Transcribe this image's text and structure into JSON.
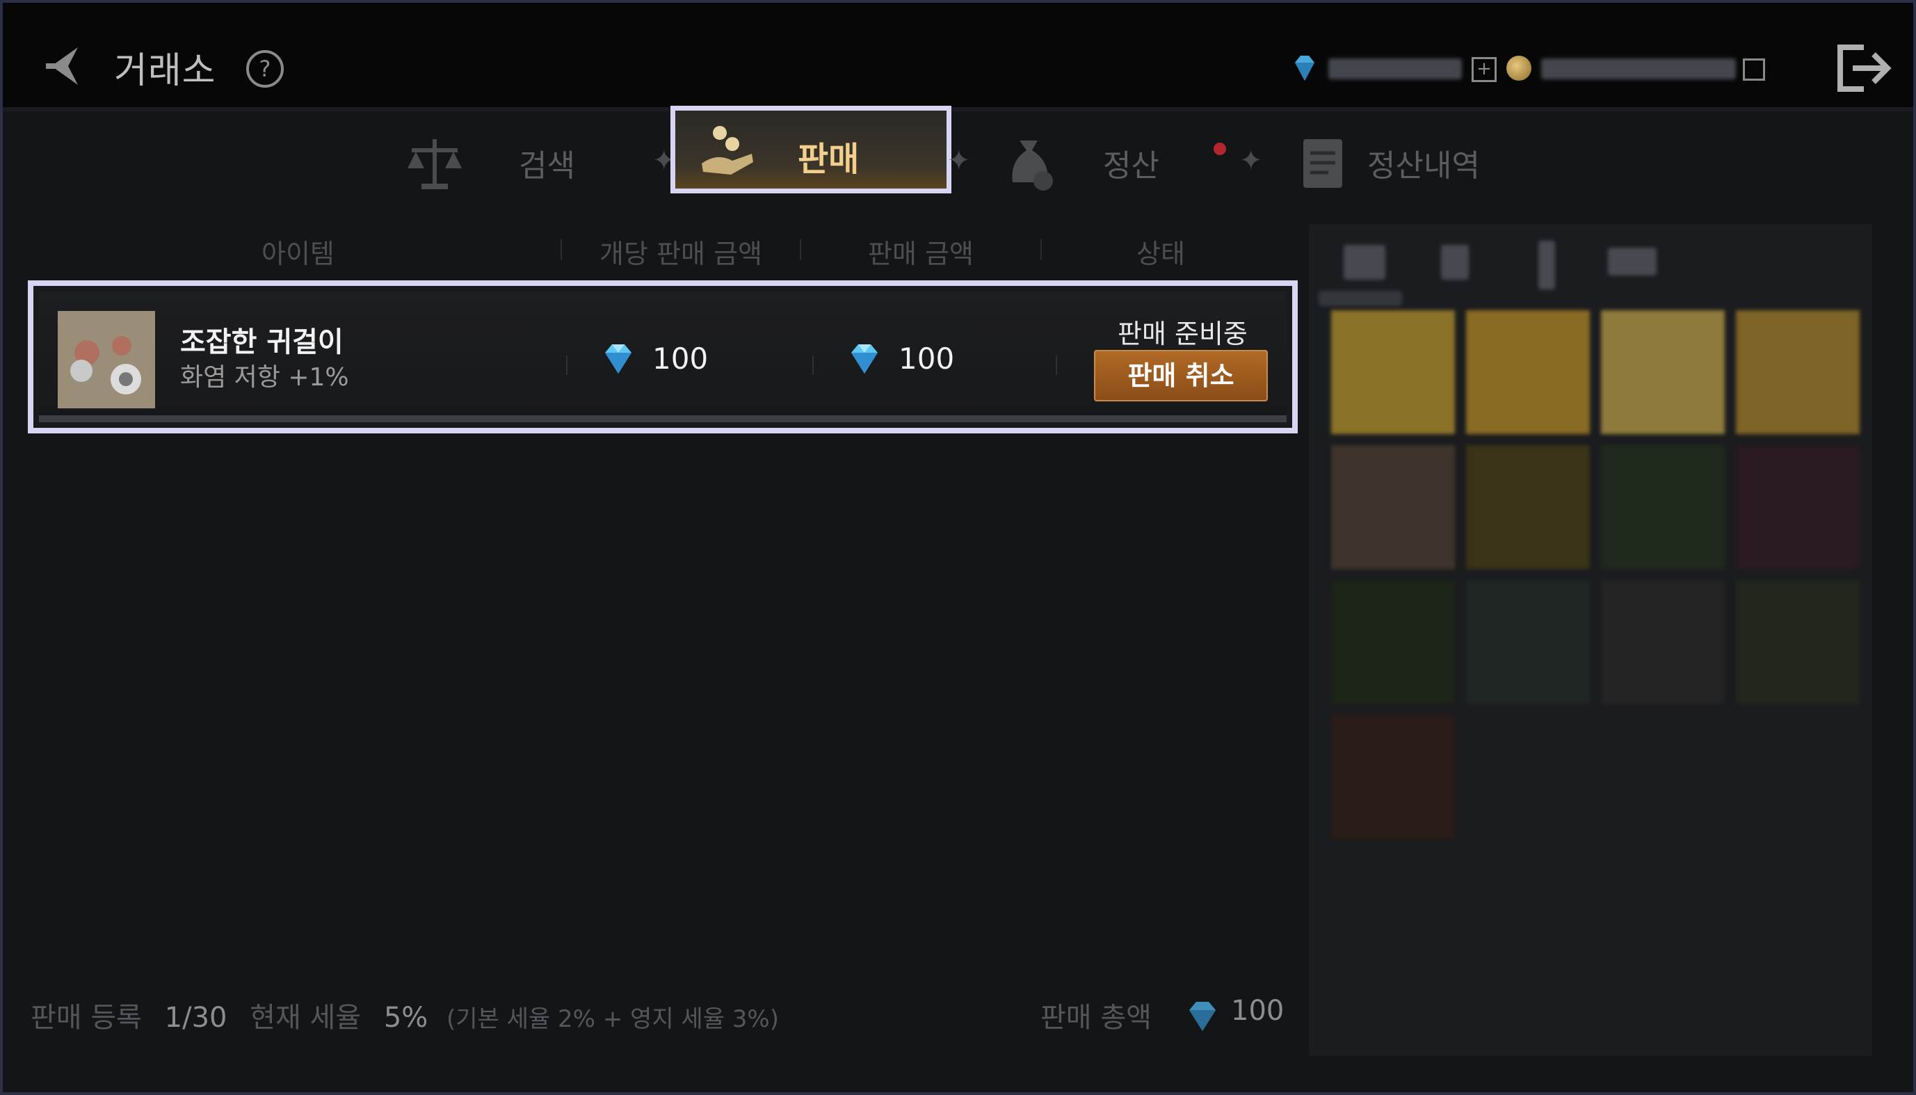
{
  "header": {
    "title": "거래소",
    "help_symbol": "?",
    "diamond_icon": "diamond-icon",
    "coin_icon": "coin-icon",
    "add_symbol": "+"
  },
  "tabs": [
    {
      "label": "검색",
      "icon": "scale-icon",
      "active": false
    },
    {
      "label": "판매",
      "icon": "coins-hand-icon",
      "active": true
    },
    {
      "label": "정산",
      "icon": "money-bag-icon",
      "active": false,
      "notification": true
    },
    {
      "label": "정산내역",
      "icon": "ledger-icon",
      "active": false
    }
  ],
  "columns": [
    "아이템",
    "개당 판매 금액",
    "판매 금액",
    "상태"
  ],
  "listing": {
    "name": "조잡한 귀걸이",
    "stat": "화염 저항 +1%",
    "unit_price": "100",
    "total_price": "100",
    "status": "판매 준비중",
    "cancel_label": "판매 취소"
  },
  "footer": {
    "registered_label": "판매 등록",
    "registered_value": "1/30",
    "tax_label": "현재 세율",
    "tax_value": "5%",
    "tax_detail": "(기본 세율 2% + 영지 세율 3%)",
    "total_label": "판매 총액",
    "total_value": "100"
  },
  "colors": {
    "accent_gold": "#f2cf8c",
    "cancel_button": "#a0601f",
    "highlight_outline": "#d7d5f2",
    "diamond": "#5ec8f2"
  }
}
